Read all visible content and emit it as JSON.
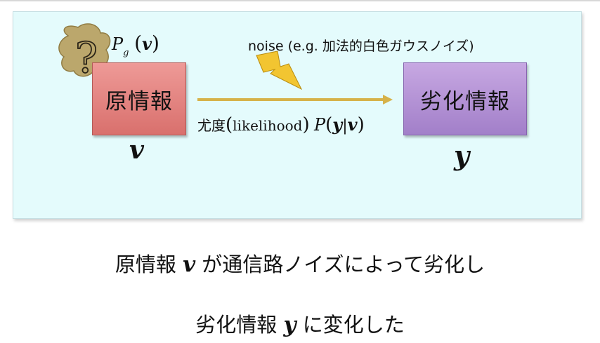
{
  "diagram": {
    "original_box": {
      "label": "原情報",
      "variable": "v",
      "color": "#e07f7c"
    },
    "degraded_box": {
      "label": "劣化情報",
      "variable": "y",
      "color": "#b08fd6"
    },
    "prior": {
      "p": "P",
      "sub": "g",
      "open": "(",
      "var": "v",
      "close": ")"
    },
    "noise_label": "noise  (e.g. 加法的白色ガウスノイズ)",
    "likelihood": {
      "jp": "尤度",
      "open": "(",
      "word": "likelihood",
      "close": ")",
      "p": "P",
      "p_open": "(",
      "y": "y",
      "bar": "|",
      "v": "v",
      "p_close": ")"
    },
    "question_icon": "question-mark-icon",
    "lightning_icon": "lightning-bolt-icon",
    "arrow_color": "#d6b24a",
    "panel_color": "#e4fbfc"
  },
  "captions": {
    "line1": {
      "pre": "原情報 ",
      "var": "v",
      "post": " が通信路ノイズによって劣化し"
    },
    "line2": {
      "pre": "劣化情報 ",
      "var": "y",
      "post": " に変化した"
    }
  }
}
